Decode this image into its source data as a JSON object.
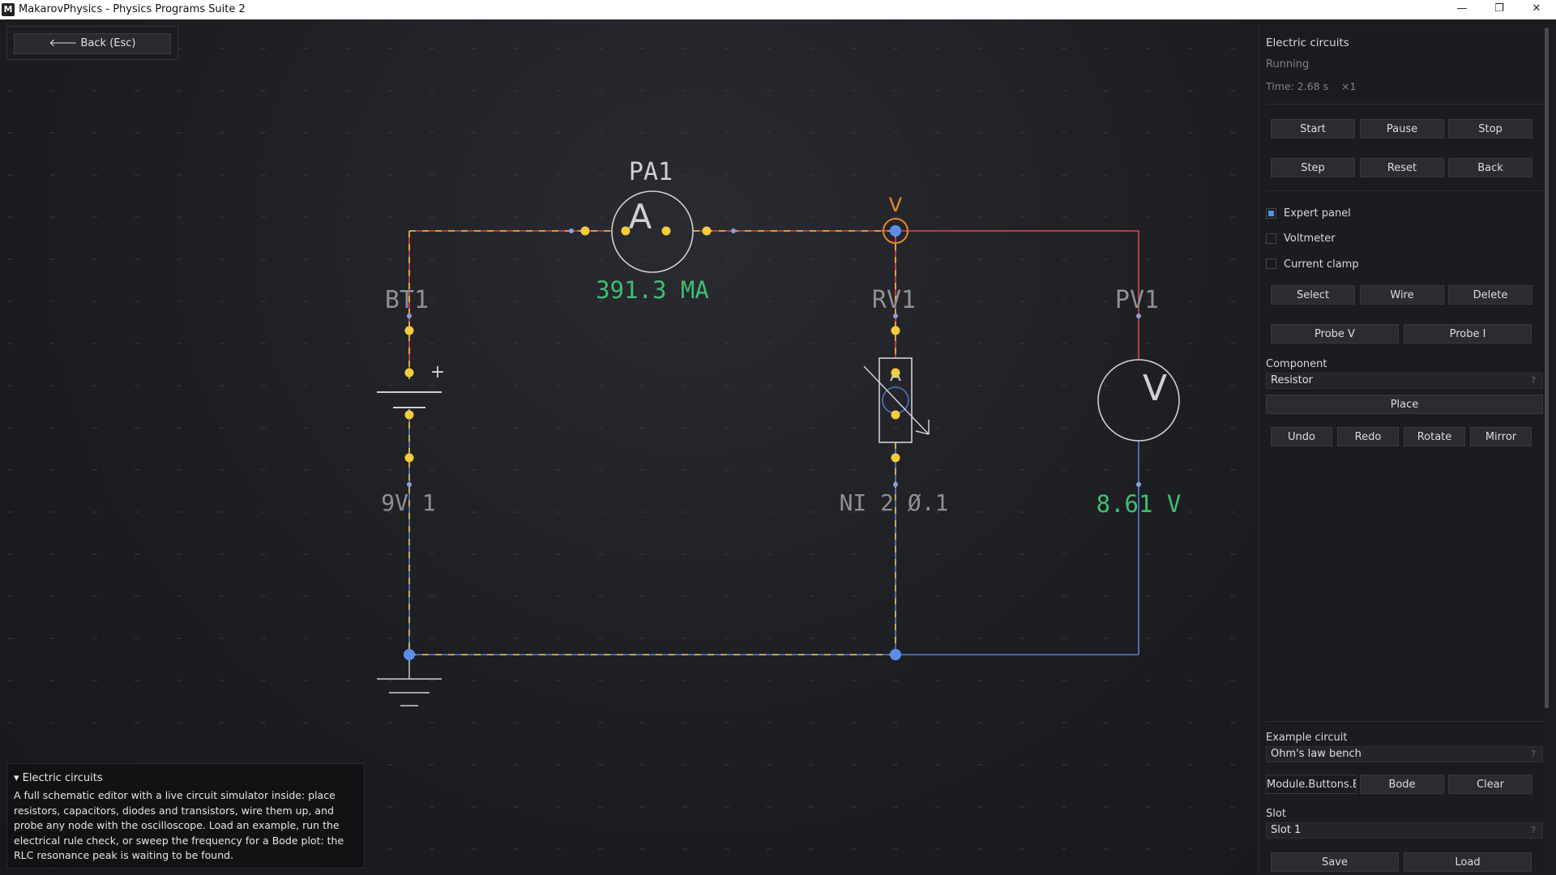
{
  "window": {
    "app_icon_letter": "M",
    "title": "MakarovPhysics - Physics Programs Suite 2",
    "minimize_glyph": "—",
    "maximize_glyph": "❐",
    "close_glyph": "✕"
  },
  "back_button": {
    "label": "🡐  Back  (Esc)"
  },
  "schematic": {
    "ammeter": {
      "ref": "PA1",
      "symbol": "A",
      "reading": "391.3 MA"
    },
    "battery": {
      "ref": "BT1",
      "value": "9V 1",
      "plus": "+"
    },
    "rheostat": {
      "ref": "RV1",
      "value": "NI 2 Ø.1",
      "symbol": "A"
    },
    "voltmeter": {
      "ref": "PV1",
      "symbol": "V",
      "reading": "8.61 V"
    },
    "probe_label": "V",
    "colors": {
      "wire_yellow": "#e8c140",
      "wire_red": "#e0454f",
      "wire_blue": "#5b7fd4",
      "node_yellow": "#f3cd3c",
      "node_blue": "#5b8ee8",
      "reading_green": "#3fbf72",
      "component_grey": "#cfd0d4",
      "probe_orange": "#e6872d"
    }
  },
  "description": {
    "heading": "▾ Electric circuits",
    "text": "A full schematic editor with a live circuit simulator inside: place resistors, capacitors, diodes and transistors, wire them up, and probe any node with the oscilloscope. Load an example, run the electrical rule check, or sweep the frequency for a Bode plot: the RLC resonance peak is waiting to be found."
  },
  "panel": {
    "title": "Electric circuits",
    "status": "Running",
    "time": "Time: 2.68 s    ×1",
    "sim_buttons": [
      "Start",
      "Pause",
      "Stop",
      "Step",
      "Reset",
      "Back"
    ],
    "checkboxes": [
      {
        "label": "Expert panel",
        "checked": true
      },
      {
        "label": "Voltmeter",
        "checked": false
      },
      {
        "label": "Current clamp",
        "checked": false
      }
    ],
    "tool_buttons": [
      "Select",
      "Wire",
      "Delete"
    ],
    "probe_buttons": [
      "Probe V",
      "Probe I"
    ],
    "component_label": "Component",
    "component_value": "Resistor",
    "help_glyph": "?",
    "place_label": "Place",
    "edit_buttons": [
      "Undo",
      "Redo",
      "Rotate",
      "Mirror"
    ],
    "example_label": "Example circuit",
    "example_value": "Ohm's law bench",
    "extra_buttons": [
      "Module.Buttons.Erc",
      "Bode",
      "Clear"
    ],
    "slot_label": "Slot",
    "slot_value": "Slot 1",
    "file_buttons": [
      "Save",
      "Load"
    ]
  }
}
